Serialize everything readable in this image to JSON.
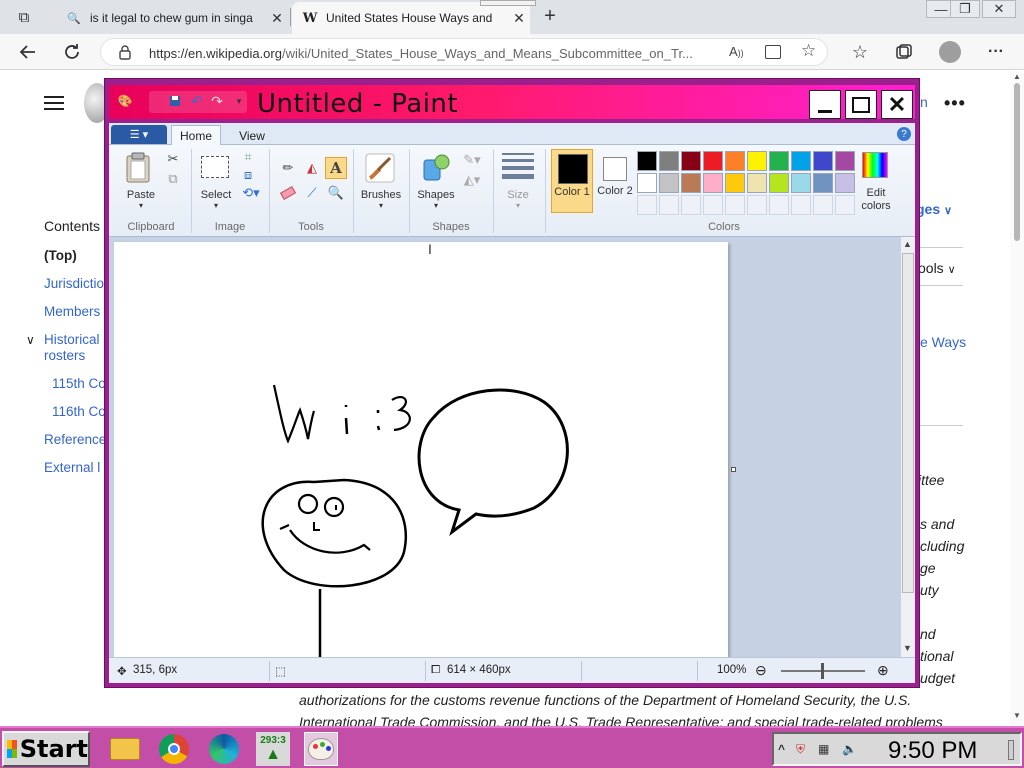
{
  "browser": {
    "tabs": [
      {
        "title": "is it legal to chew gum in singa",
        "icon": "search-icon",
        "icon_glyph": "🔍"
      },
      {
        "title": "United States House Ways and",
        "icon": "wikipedia-icon",
        "icon_glyph": "W"
      }
    ],
    "close_glyph": "✕",
    "new_tab_glyph": "+",
    "url": {
      "domain": "https://en.wikipedia.org",
      "path": "/wiki/United_States_House_Ways_and_Means_Subcommittee_on_Tr..."
    },
    "window_controls": {
      "minimize": "—",
      "restore": "❐",
      "close": "✕"
    }
  },
  "wiki": {
    "contents_title": "Contents",
    "toc": [
      {
        "label": "(Top)",
        "bold": true
      },
      {
        "label": "Jurisdictio",
        "bold": false
      },
      {
        "label": "Members",
        "bold": false
      },
      {
        "label": "Historical",
        "bold": false
      },
      {
        "label": "rosters",
        "bold": false
      },
      {
        "label": "115th Co",
        "bold": false
      },
      {
        "label": "116th Co",
        "bold": false
      },
      {
        "label": "Reference",
        "bold": false
      },
      {
        "label": "External l",
        "bold": false
      }
    ],
    "right_fragments": {
      "top_link": "n",
      "languages": "ges",
      "tools": "ools",
      "ways": "e Ways",
      "ittee": "ittee",
      "s_and": "s and",
      "cluding": "cluding",
      "ge": "ge",
      "uty": "uty",
      "nd": "nd",
      "tional": "tional",
      "udget": "udget"
    },
    "bottom_line_1": "authorizations for the customs revenue functions of the Department of Homeland Security, the U.S.",
    "bottom_line_2": "International Trade Commission, and the U.S. Trade Representative; and special trade-related problems"
  },
  "paint": {
    "title": "Untitled - Paint",
    "ribbon_tabs": [
      "Home",
      "View"
    ],
    "groups": {
      "clipboard": "Clipboard",
      "image": "Image",
      "tools": "Tools",
      "shapes": "Shapes",
      "colors": "Colors"
    },
    "buttons": {
      "paste": "Paste",
      "select": "Select",
      "brushes": "Brushes",
      "shapes": "Shapes",
      "size": "Size",
      "color1": "Color 1",
      "color2": "Color 2",
      "edit_colors": "Edit colors"
    },
    "palette_row1": [
      "#000000",
      "#7f7f7f",
      "#880015",
      "#ed1c24",
      "#ff7f27",
      "#fff200",
      "#22b14c",
      "#00a2e8",
      "#3f48cc",
      "#a349a4"
    ],
    "palette_row2": [
      "#ffffff",
      "#c3c3c3",
      "#b97a57",
      "#ffaec9",
      "#ffc90e",
      "#efe4b0",
      "#b5e61d",
      "#99d9ea",
      "#7092be",
      "#c8bfe7"
    ],
    "color1": "#000000",
    "color2": "#ffffff",
    "status": {
      "cursor": "315, 6px",
      "size": "614 × 460px",
      "zoom": "100%"
    },
    "drawing_text": "wi:3"
  },
  "taskbar": {
    "start": "Start",
    "badge": "293:3",
    "clock": "9:50 PM"
  }
}
